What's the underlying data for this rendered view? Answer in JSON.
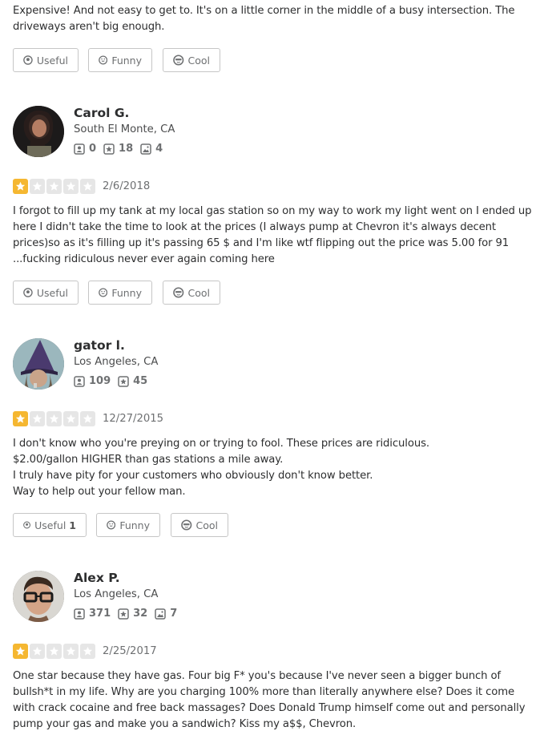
{
  "reviews": [
    {
      "text": "Expensive! And not easy to get to. It's on a little corner in the middle of a busy intersection. The driveways aren't big enough.",
      "buttons": {
        "useful": "Useful",
        "funny": "Funny",
        "cool": "Cool"
      }
    },
    {
      "user": {
        "name": "Carol G.",
        "location": "South El Monte, CA",
        "friends": "0",
        "reviews": "18",
        "photos": "4"
      },
      "rating": 1,
      "date": "2/6/2018",
      "text": "I forgot to fill up my tank at my local gas station so on my way to work my light went on I ended up here I didn't take the time to look at the prices (I always pump at Chevron it's always decent prices)so as it's filling up it's passing 65 $ and I'm like wtf flipping out the price was 5.00 for 91 ...fucking ridiculous never ever again coming here",
      "buttons": {
        "useful": "Useful",
        "funny": "Funny",
        "cool": "Cool"
      }
    },
    {
      "user": {
        "name": "gator l.",
        "location": "Los Angeles, CA",
        "friends": "109",
        "reviews": "45"
      },
      "rating": 1,
      "date": "12/27/2015",
      "text": "I don't know who you're preying on or trying to fool. These prices are ridiculous.\n$2.00/gallon HIGHER than gas stations a mile away.\nI truly have pity for your customers who obviously don't know better.\nWay to help out your fellow man.",
      "buttons": {
        "useful": "Useful",
        "useful_count": "1",
        "funny": "Funny",
        "cool": "Cool"
      }
    },
    {
      "user": {
        "name": "Alex P.",
        "location": "Los Angeles, CA",
        "friends": "371",
        "reviews": "32",
        "photos": "7"
      },
      "rating": 1,
      "date": "2/25/2017",
      "text": "One star because they have gas. Four big F* you's because I've never seen a bigger bunch of bullsh*t in my life. Why are you charging 100% more than literally anywhere else? Does it come with crack cocaine and free back massages? Does Donald Trump himself come out and personally pump your gas and make you a sandwich? Kiss my a$$, Chevron."
    }
  ],
  "colors": {
    "star_filled": "#f5b731",
    "star_empty": "#e6e6e6",
    "text": "#2d2e2f",
    "muted": "#6e7072"
  },
  "icons": {
    "useful": "lightbulb-icon",
    "funny": "smiley-icon",
    "cool": "sunglasses-icon",
    "friends": "friends-icon",
    "reviews": "star-box-icon",
    "photos": "photo-icon"
  }
}
